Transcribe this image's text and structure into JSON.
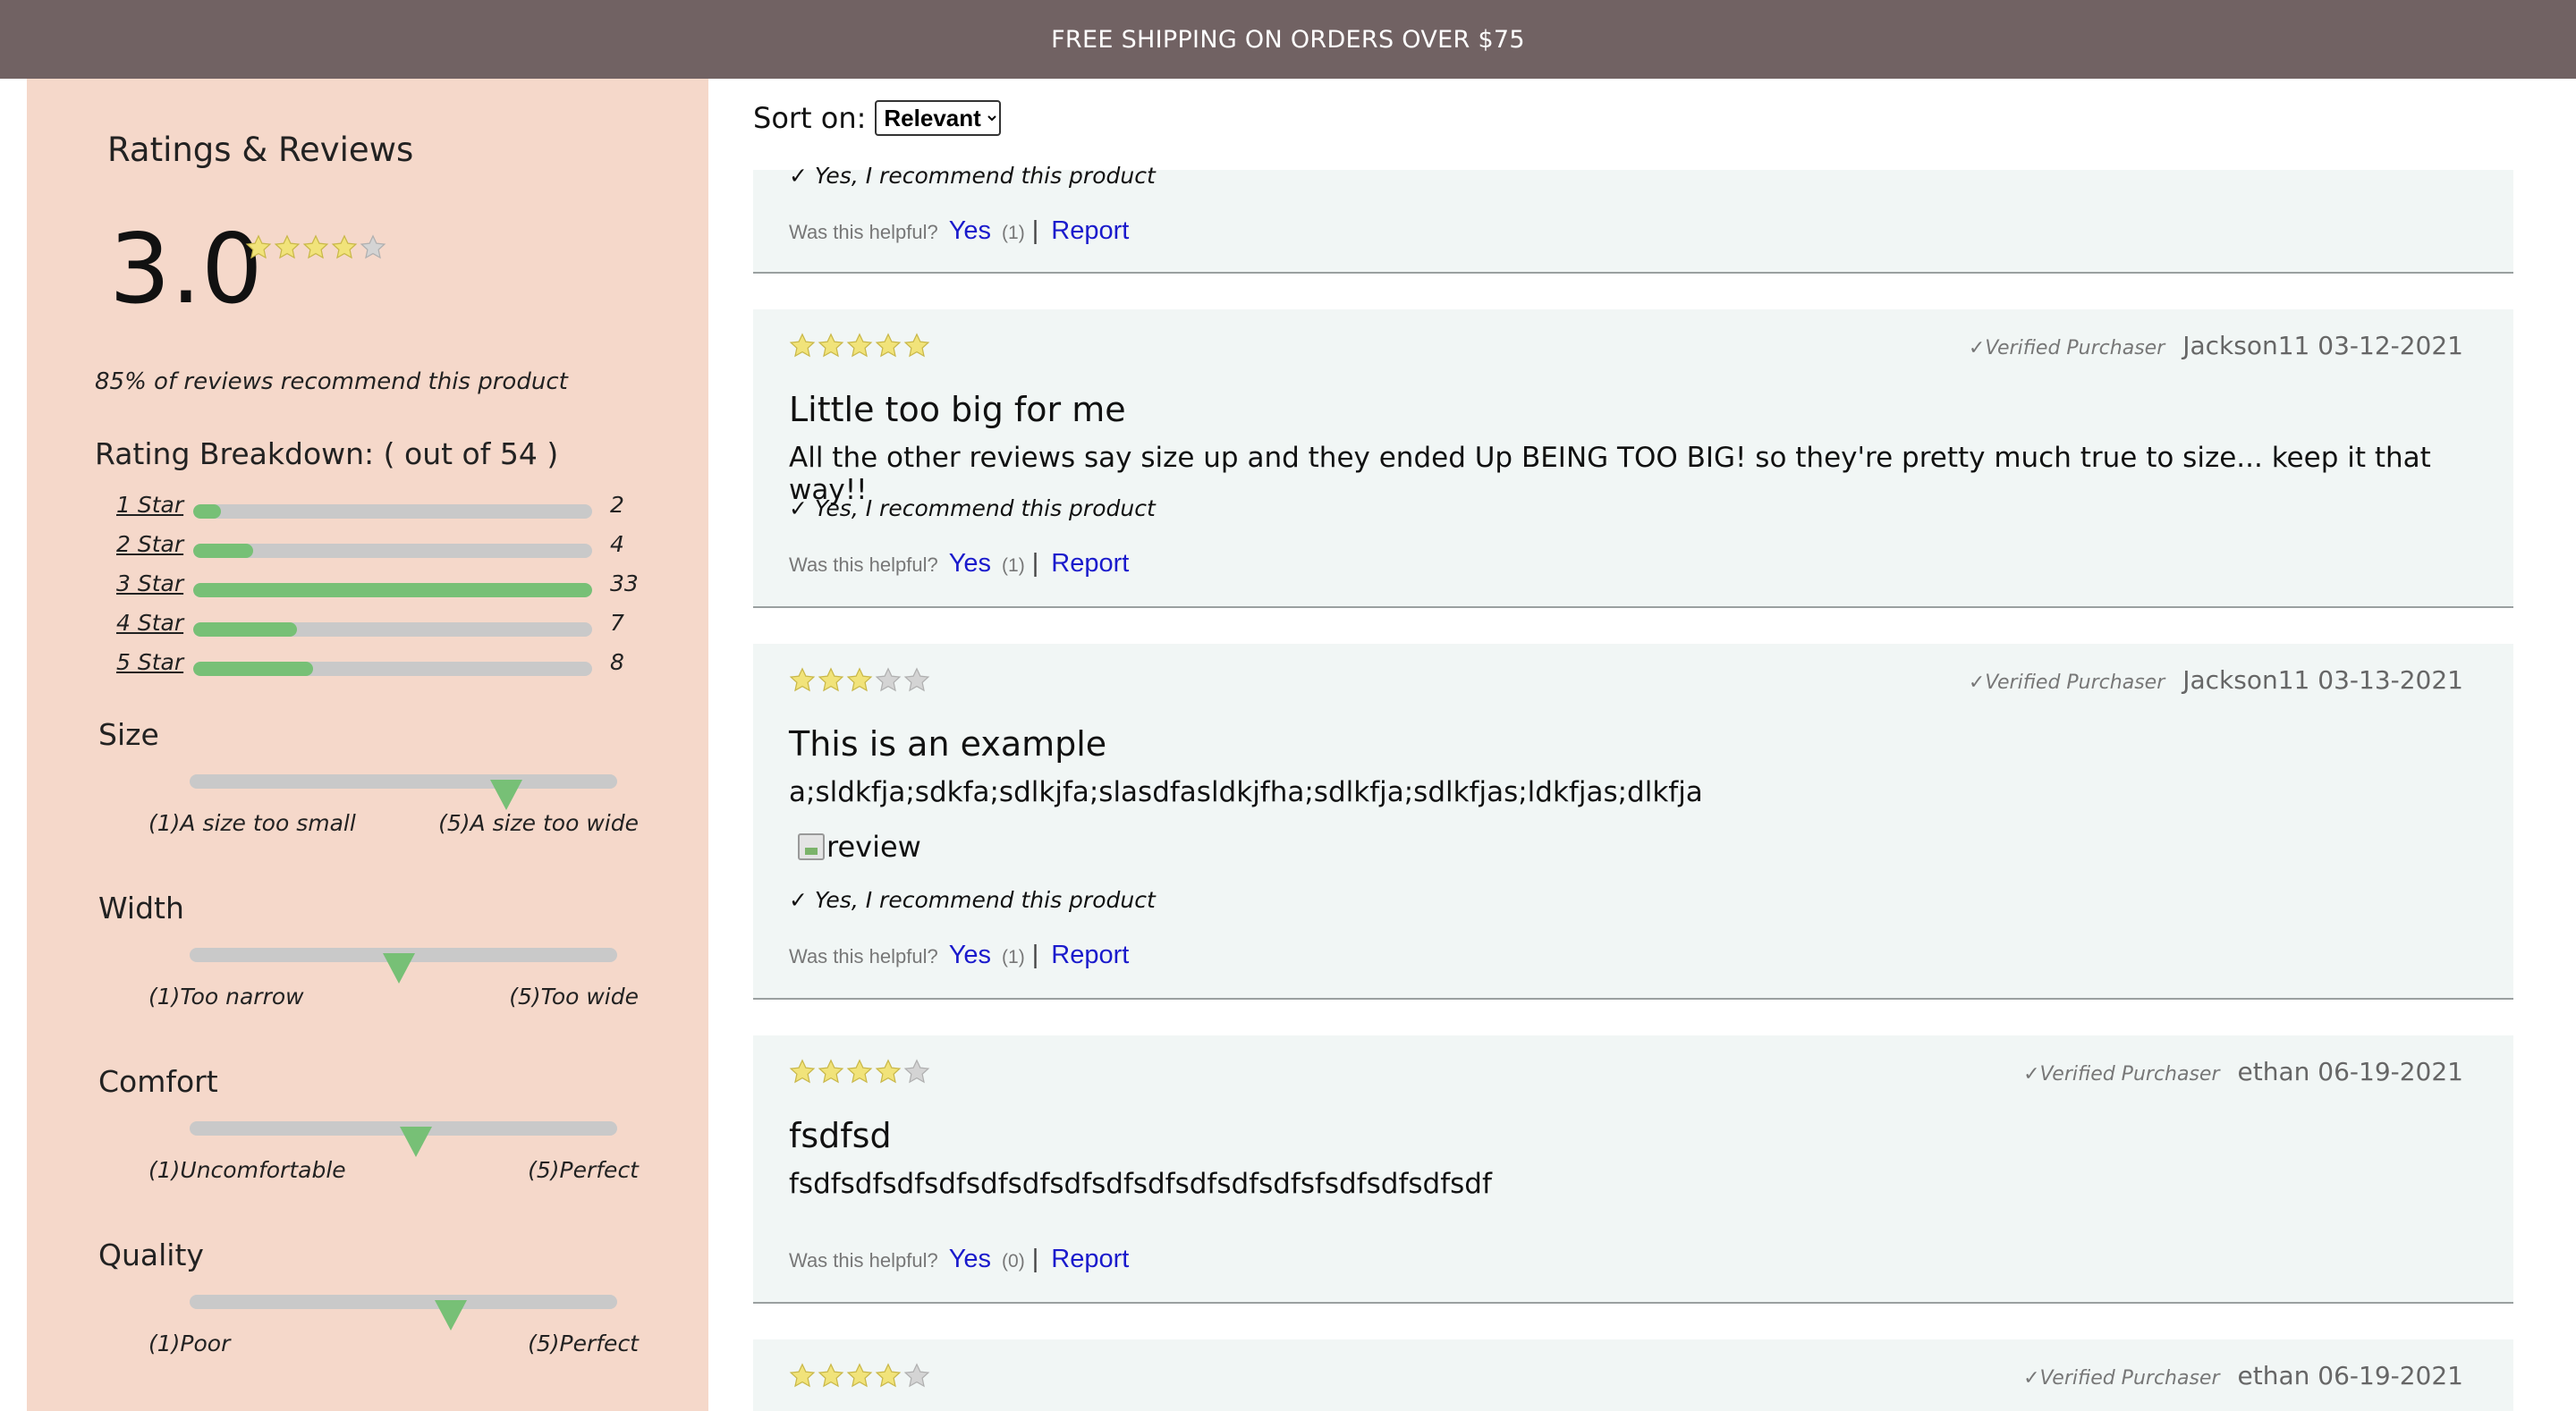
{
  "banner": {
    "text": "FREE SHIPPING ON ORDERS OVER $75"
  },
  "ratings": {
    "title": "Ratings & Reviews",
    "average": "3.0",
    "average_stars": 4,
    "recommend_text": "85% of reviews recommend this product",
    "breakdown_title": "Rating Breakdown: ( out of 54 )",
    "breakdown": [
      {
        "label": "1 Star",
        "count": "2",
        "fraction": 0.07
      },
      {
        "label": "2 Star",
        "count": "4",
        "fraction": 0.15
      },
      {
        "label": "3 Star",
        "count": "33",
        "fraction": 1.0
      },
      {
        "label": "4 Star",
        "count": "7",
        "fraction": 0.26
      },
      {
        "label": "5 Star",
        "count": "8",
        "fraction": 0.3
      }
    ],
    "characteristics": [
      {
        "name": "Size",
        "min": "(1)A size too small",
        "max": "(5)A size too wide",
        "fraction": 0.74
      },
      {
        "name": "Width",
        "min": "(1)Too narrow",
        "max": "(5)Too wide",
        "fraction": 0.49
      },
      {
        "name": "Comfort",
        "min": "(1)Uncomfortable",
        "max": "(5)Perfect",
        "fraction": 0.53
      },
      {
        "name": "Quality",
        "min": "(1)Poor",
        "max": "(5)Perfect",
        "fraction": 0.61
      }
    ]
  },
  "sort": {
    "label": "Sort on:",
    "selected": "Relevant"
  },
  "helpful_label": "Was this helpful?",
  "yes_label": "Yes",
  "report_label": "Report",
  "separator": "|",
  "reviews": [
    {
      "recommend": "✓ Yes, I recommend this product",
      "helpful_count": "(1)"
    },
    {
      "stars": 5,
      "verified": "✓Verified Purchaser",
      "user_date": "Jackson11 03-12-2021",
      "title": "Little too big for me",
      "body": "All the other reviews say size up and they ended Up BEING TOO BIG! so they're pretty much true to size... keep it that way!!",
      "recommend": "✓ Yes, I recommend this product",
      "helpful_count": "(1)"
    },
    {
      "stars": 3,
      "verified": "✓Verified Purchaser",
      "user_date": "Jackson11 03-13-2021",
      "title": "This is an example",
      "body": "a;sldkfja;sdkfa;sdlkjfa;slasdfasldkjfha;sdlkfja;sdlkfjas;ldkfjas;dlkfja",
      "image_alt": "review",
      "recommend": "✓ Yes, I recommend this product",
      "helpful_count": "(1)"
    },
    {
      "stars": 4,
      "verified": "✓Verified Purchaser",
      "user_date": "ethan 06-19-2021",
      "title": "fsdfsd",
      "body": "fsdfsdfsdfsdfsdfsdfsdfsdfsdfsdfsdfsdfsfsdfsdfsdfsdf",
      "helpful_count": "(0)"
    },
    {
      "stars": 4,
      "verified": "✓Verified Purchaser",
      "user_date": "ethan 06-19-2021"
    }
  ]
}
